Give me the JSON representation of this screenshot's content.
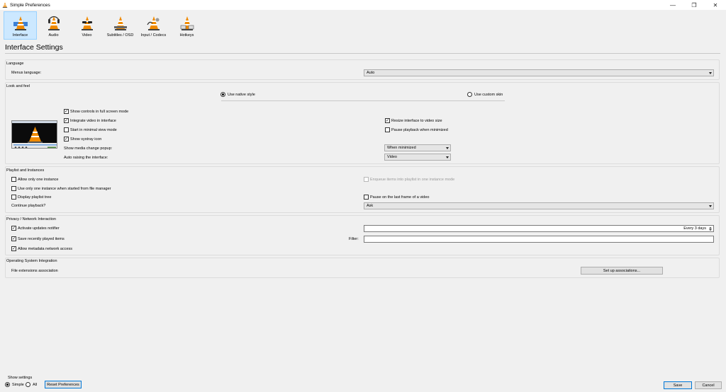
{
  "window": {
    "title": "Simple Preferences"
  },
  "toolbar": [
    {
      "label": "Interface",
      "selected": true
    },
    {
      "label": "Audio",
      "selected": false
    },
    {
      "label": "Video",
      "selected": false
    },
    {
      "label": "Subtitles / OSD",
      "selected": false
    },
    {
      "label": "Input / Codecs",
      "selected": false
    },
    {
      "label": "Hotkeys",
      "selected": false
    }
  ],
  "page": {
    "title": "Interface Settings"
  },
  "language": {
    "group_title": "Language",
    "menus_label": "Menus language:",
    "menus_value": "Auto"
  },
  "look": {
    "group_title": "Look and feel",
    "native_style": "Use native style",
    "custom_skin": "Use custom skin",
    "show_controls_fullscreen": "Show controls in full screen mode",
    "integrate_video": "Integrate video in interface",
    "start_minimal": "Start in minimal view mode",
    "show_systray": "Show systray icon",
    "resize_interface": "Resize interface to video size",
    "pause_minimized": "Pause playback when minimized",
    "media_popup_label": "Show media change popup:",
    "media_popup_value": "When minimized",
    "auto_raise_label": "Auto raising the interface:",
    "auto_raise_value": "Video"
  },
  "playlist": {
    "group_title": "Playlist and Instances",
    "allow_one_instance": "Allow only one instance",
    "enqueue_items": "Enqueue items into playlist in one instance mode",
    "one_instance_file_manager": "Use only one instance when started from file manager",
    "display_tree": "Display playlist tree",
    "pause_last_frame": "Pause on the last frame of a video",
    "continue_label": "Continue playback?",
    "continue_value": "Ask"
  },
  "privacy": {
    "group_title": "Privacy / Network Interaction",
    "updates_notifier": "Activate updates notifier",
    "updates_value": "Every 3 days",
    "save_recent": "Save recently played items",
    "filter_label": "Filter:",
    "filter_value": "",
    "metadata_access": "Allow metadata network access"
  },
  "os": {
    "group_title": "Operating System Integration",
    "file_ext_label": "File extensions association",
    "setup_button": "Set up associations..."
  },
  "footer": {
    "show_settings": "Show settings",
    "simple": "Simple",
    "all": "All",
    "reset": "Reset Preferences",
    "save": "Save",
    "cancel": "Cancel"
  },
  "colors": {
    "selected_tab_bg": "#cce8ff",
    "selected_tab_border": "#99d1ff",
    "default_button_border": "#0078d7",
    "cone_orange": "#f08a00"
  }
}
